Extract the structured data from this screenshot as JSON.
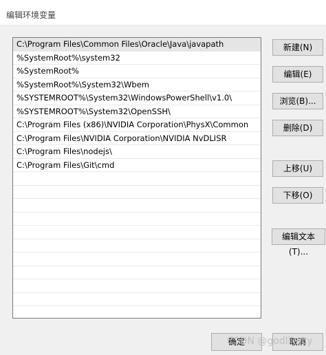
{
  "dialog": {
    "title": "编辑环境变量"
  },
  "list": {
    "items": [
      "C:\\Program Files\\Common Files\\Oracle\\Java\\javapath",
      "%SystemRoot%\\system32",
      "%SystemRoot%",
      "%SystemRoot%\\System32\\Wbem",
      "%SYSTEMROOT%\\System32\\WindowsPowerShell\\v1.0\\",
      "%SYSTEMROOT%\\System32\\OpenSSH\\",
      "C:\\Program Files (x86)\\NVIDIA Corporation\\PhysX\\Common",
      "C:\\Program Files\\NVIDIA Corporation\\NVIDIA NvDLISR",
      "C:\\Program Files\\nodejs\\",
      "C:\\Program Files\\Git\\cmd"
    ]
  },
  "buttons": {
    "new": "新建(N)",
    "edit": "编辑(E)",
    "browse": "浏览(B)...",
    "delete": "删除(D)",
    "move_up": "上移(U)",
    "move_down": "下移(O)",
    "edit_text": "编辑文本(T)..."
  },
  "footer": {
    "ok": "确定",
    "cancel": "取消"
  },
  "watermark": "CSDN @godlikecy"
}
